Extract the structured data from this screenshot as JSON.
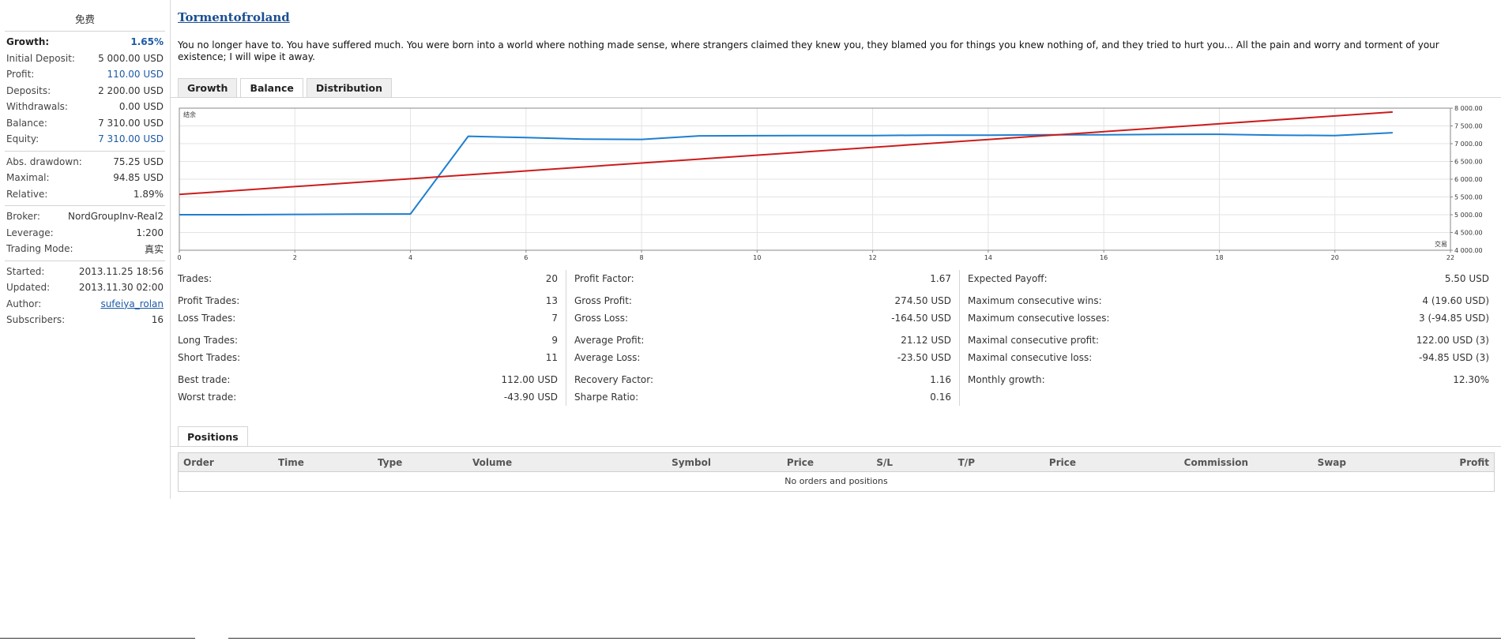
{
  "sidebar": {
    "header": "免费",
    "stats": [
      {
        "label": "Growth:",
        "value": "1.65%"
      },
      {
        "label": "Initial Deposit:",
        "value": "5 000.00 USD"
      },
      {
        "label": "Profit:",
        "value": "110.00 USD"
      },
      {
        "label": "Deposits:",
        "value": "2 200.00 USD"
      },
      {
        "label": "Withdrawals:",
        "value": "0.00 USD"
      },
      {
        "label": "Balance:",
        "value": "7 310.00 USD"
      },
      {
        "label": "Equity:",
        "value": "7 310.00 USD"
      }
    ],
    "drawdown": [
      {
        "label": "Abs. drawdown:",
        "value": "75.25 USD"
      },
      {
        "label": "Maximal:",
        "value": "94.85 USD"
      },
      {
        "label": "Relative:",
        "value": "1.89%"
      }
    ],
    "account": [
      {
        "label": "Broker:",
        "value": "NordGroupInv-Real2"
      },
      {
        "label": "Leverage:",
        "value": "1:200"
      },
      {
        "label": "Trading Mode:",
        "value": "真实"
      }
    ],
    "meta": [
      {
        "label": "Started:",
        "value": "2013.11.25 18:56"
      },
      {
        "label": "Updated:",
        "value": "2013.11.30 02:00"
      },
      {
        "label": "Author:",
        "value": "sufeiya_rolan"
      },
      {
        "label": "Subscribers:",
        "value": "16"
      }
    ]
  },
  "main": {
    "title": "Tormentofroland",
    "description": "You no longer have to. You have suffered much. You were born into a world where nothing made sense, where strangers claimed they knew you, they blamed you for things you knew nothing of, and they tried to hurt you... All the pain and worry and torment of your existence; I will wipe it away.",
    "tabs": [
      {
        "label": "Growth"
      },
      {
        "label": "Balance"
      },
      {
        "label": "Distribution"
      }
    ],
    "active_tab": "Balance",
    "stats": {
      "col1": [
        {
          "label": "Trades:",
          "value": "20"
        },
        {
          "label": "Profit Trades:",
          "value": "13"
        },
        {
          "label": "Loss Trades:",
          "value": "7"
        },
        {
          "label": "Long Trades:",
          "value": "9"
        },
        {
          "label": "Short Trades:",
          "value": "11"
        },
        {
          "label": "Best trade:",
          "value": "112.00 USD"
        },
        {
          "label": "Worst trade:",
          "value": "-43.90 USD"
        }
      ],
      "col2": [
        {
          "label": "Profit Factor:",
          "value": "1.67"
        },
        {
          "label": "Gross Profit:",
          "value": "274.50 USD"
        },
        {
          "label": "Gross Loss:",
          "value": "-164.50 USD"
        },
        {
          "label": "Average Profit:",
          "value": "21.12 USD"
        },
        {
          "label": "Average Loss:",
          "value": "-23.50 USD"
        },
        {
          "label": "Recovery Factor:",
          "value": "1.16"
        },
        {
          "label": "Sharpe Ratio:",
          "value": "0.16"
        }
      ],
      "col3": [
        {
          "label": "Expected Payoff:",
          "value": "5.50 USD"
        },
        {
          "label": "Maximum consecutive wins:",
          "value": "4 (19.60 USD)"
        },
        {
          "label": "Maximum consecutive losses:",
          "value": "3 (-94.85 USD)"
        },
        {
          "label": "Maximal consecutive profit:",
          "value": "122.00 USD (3)"
        },
        {
          "label": "Maximal consecutive loss:",
          "value": "-94.85 USD (3)"
        },
        {
          "label": "Monthly growth:",
          "value": "12.30%"
        }
      ]
    },
    "positions": {
      "tab_label": "Positions",
      "columns": [
        "Order",
        "Time",
        "Type",
        "Volume",
        "Symbol",
        "Price",
        "S/L",
        "T/P",
        "Price",
        "Commission",
        "Swap",
        "Profit"
      ],
      "empty_text": "No orders and positions"
    }
  },
  "chart_data": {
    "type": "line",
    "ylabel": "结余",
    "xlabel": "交易",
    "xlim": [
      0,
      22
    ],
    "ylim": [
      4000,
      8000
    ],
    "x_ticks": [
      "0",
      "2",
      "4",
      "6",
      "8",
      "10",
      "12",
      "14",
      "16",
      "18",
      "20",
      "22"
    ],
    "y_ticks": [
      "4 000.00",
      "4 500.00",
      "5 000.00",
      "5 500.00",
      "6 000.00",
      "6 500.00",
      "7 000.00",
      "7 500.00",
      "8 000.00"
    ],
    "grid": true,
    "series": [
      {
        "color": "#1e7fd0",
        "x": [
          0,
          1,
          2,
          3,
          4,
          5,
          6,
          7,
          8,
          9,
          10,
          11,
          12,
          13,
          14,
          15,
          16,
          17,
          18,
          19,
          20,
          21
        ],
        "y": [
          5000,
          5000,
          5010,
          5015,
          5020,
          7210,
          7170,
          7130,
          7120,
          7220,
          7225,
          7230,
          7230,
          7240,
          7240,
          7250,
          7250,
          7260,
          7265,
          7240,
          7230,
          7310
        ]
      },
      {
        "color": "#cc1b1b",
        "x": [
          0,
          21
        ],
        "y": [
          5570,
          7890
        ]
      }
    ]
  }
}
